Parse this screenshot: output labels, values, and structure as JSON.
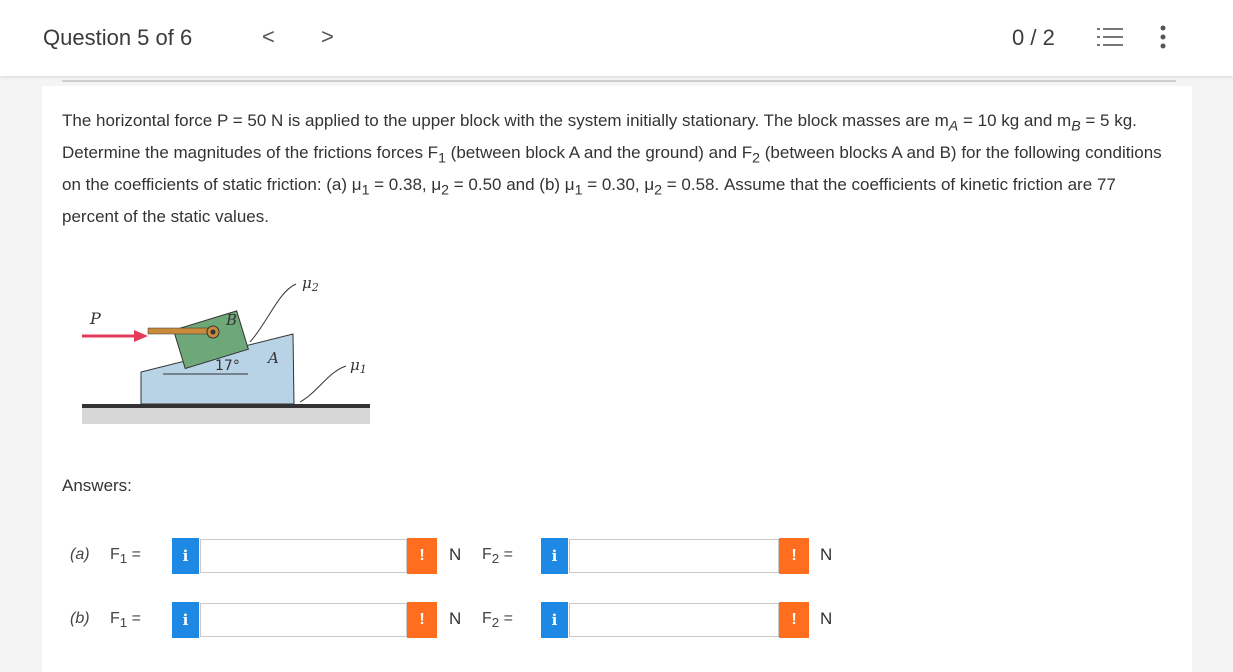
{
  "header": {
    "question_label": "Question 5 of 6",
    "prev_label": "<",
    "next_label": ">",
    "score": "0 / 2"
  },
  "question": {
    "line1": "The horizontal force P = 50 N is applied to the upper block with the system initially stationary. The block masses are m",
    "mA_sub": "A",
    "mA_val": " = 10 kg and m",
    "mB_sub": "B",
    "line2": " = 5 kg. Determine the magnitudes of the frictions forces F",
    "f1_sub": "1",
    "line2b": " (between block A and the ground) and F",
    "f2_sub": "2",
    "line2c": " (between blocks A and B) for the following conditions on the coefficients of static friction: (a) μ",
    "mu1a_sub": "1",
    "line3a": " = 0.38, μ",
    "mu2a_sub": "2",
    "line3b": " = 0.50 and (b) μ",
    "mu1b_sub": "1",
    "line3c": " = 0.30, μ",
    "mu2b_sub": "2",
    "line3d": " = 0.58. Assume that the coefficients of kinetic friction are 77 percent of the static values."
  },
  "figure": {
    "force_label": "P",
    "block_b_label": "B",
    "block_a_label": "A",
    "angle_label": "17°",
    "mu2_label": "μ",
    "mu2_sub": "2",
    "mu1_label": "μ",
    "mu1_sub": "1"
  },
  "answers": {
    "heading": "Answers:",
    "rows": [
      {
        "part": "(a)",
        "f1_label": "F",
        "f1_sub": "1",
        "eq": " =",
        "f2_label": "F",
        "f2_sub": "2",
        "unit": "N",
        "f1_value": "",
        "f2_value": ""
      },
      {
        "part": "(b)",
        "f1_label": "F",
        "f1_sub": "1",
        "eq": " =",
        "f2_label": "F",
        "f2_sub": "2",
        "unit": "N",
        "f1_value": "",
        "f2_value": ""
      }
    ],
    "info_symbol": "i",
    "warn_symbol": "!"
  },
  "colors": {
    "info": "#1e88e5",
    "warn": "#ff6d1f",
    "block_a": "#b9d3e6",
    "block_b": "#6fa878",
    "force_arrow": "#e23a5a"
  }
}
